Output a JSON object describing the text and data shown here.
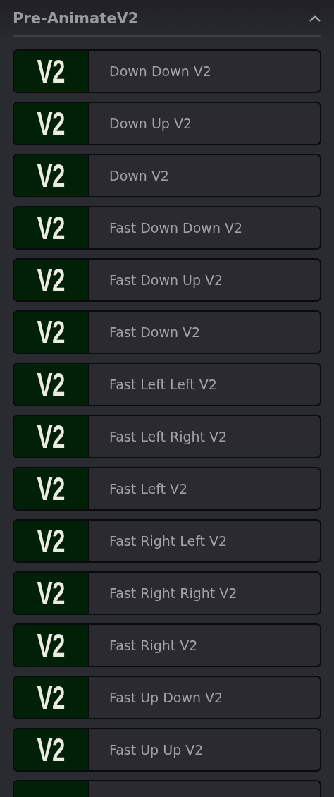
{
  "panel": {
    "title": "Pre-AnimateV2",
    "expanded": true
  },
  "items": [
    {
      "kind": "full",
      "badge": "V2",
      "label": "Down Down V2"
    },
    {
      "kind": "full",
      "badge": "V2",
      "label": "Down Up V2"
    },
    {
      "kind": "full",
      "badge": "V2",
      "label": "Down V2"
    },
    {
      "kind": "full",
      "badge": "V2",
      "label": "Fast Down Down V2"
    },
    {
      "kind": "full",
      "badge": "V2",
      "label": "Fast Down Up V2"
    },
    {
      "kind": "full",
      "badge": "V2",
      "label": "Fast Down V2"
    },
    {
      "kind": "full",
      "badge": "V2",
      "label": "Fast Left Left V2"
    },
    {
      "kind": "full",
      "badge": "V2",
      "label": "Fast Left Right V2"
    },
    {
      "kind": "full",
      "badge": "V2",
      "label": "Fast Left V2"
    },
    {
      "kind": "full",
      "badge": "V2",
      "label": "Fast Right Left V2"
    },
    {
      "kind": "full",
      "badge": "V2",
      "label": "Fast Right Right V2"
    },
    {
      "kind": "full",
      "badge": "V2",
      "label": "Fast Right V2"
    },
    {
      "kind": "full",
      "badge": "V2",
      "label": "Fast Up Down V2"
    },
    {
      "kind": "full",
      "badge": "V2",
      "label": "Fast Up Up V2"
    },
    {
      "kind": "partial"
    }
  ]
}
